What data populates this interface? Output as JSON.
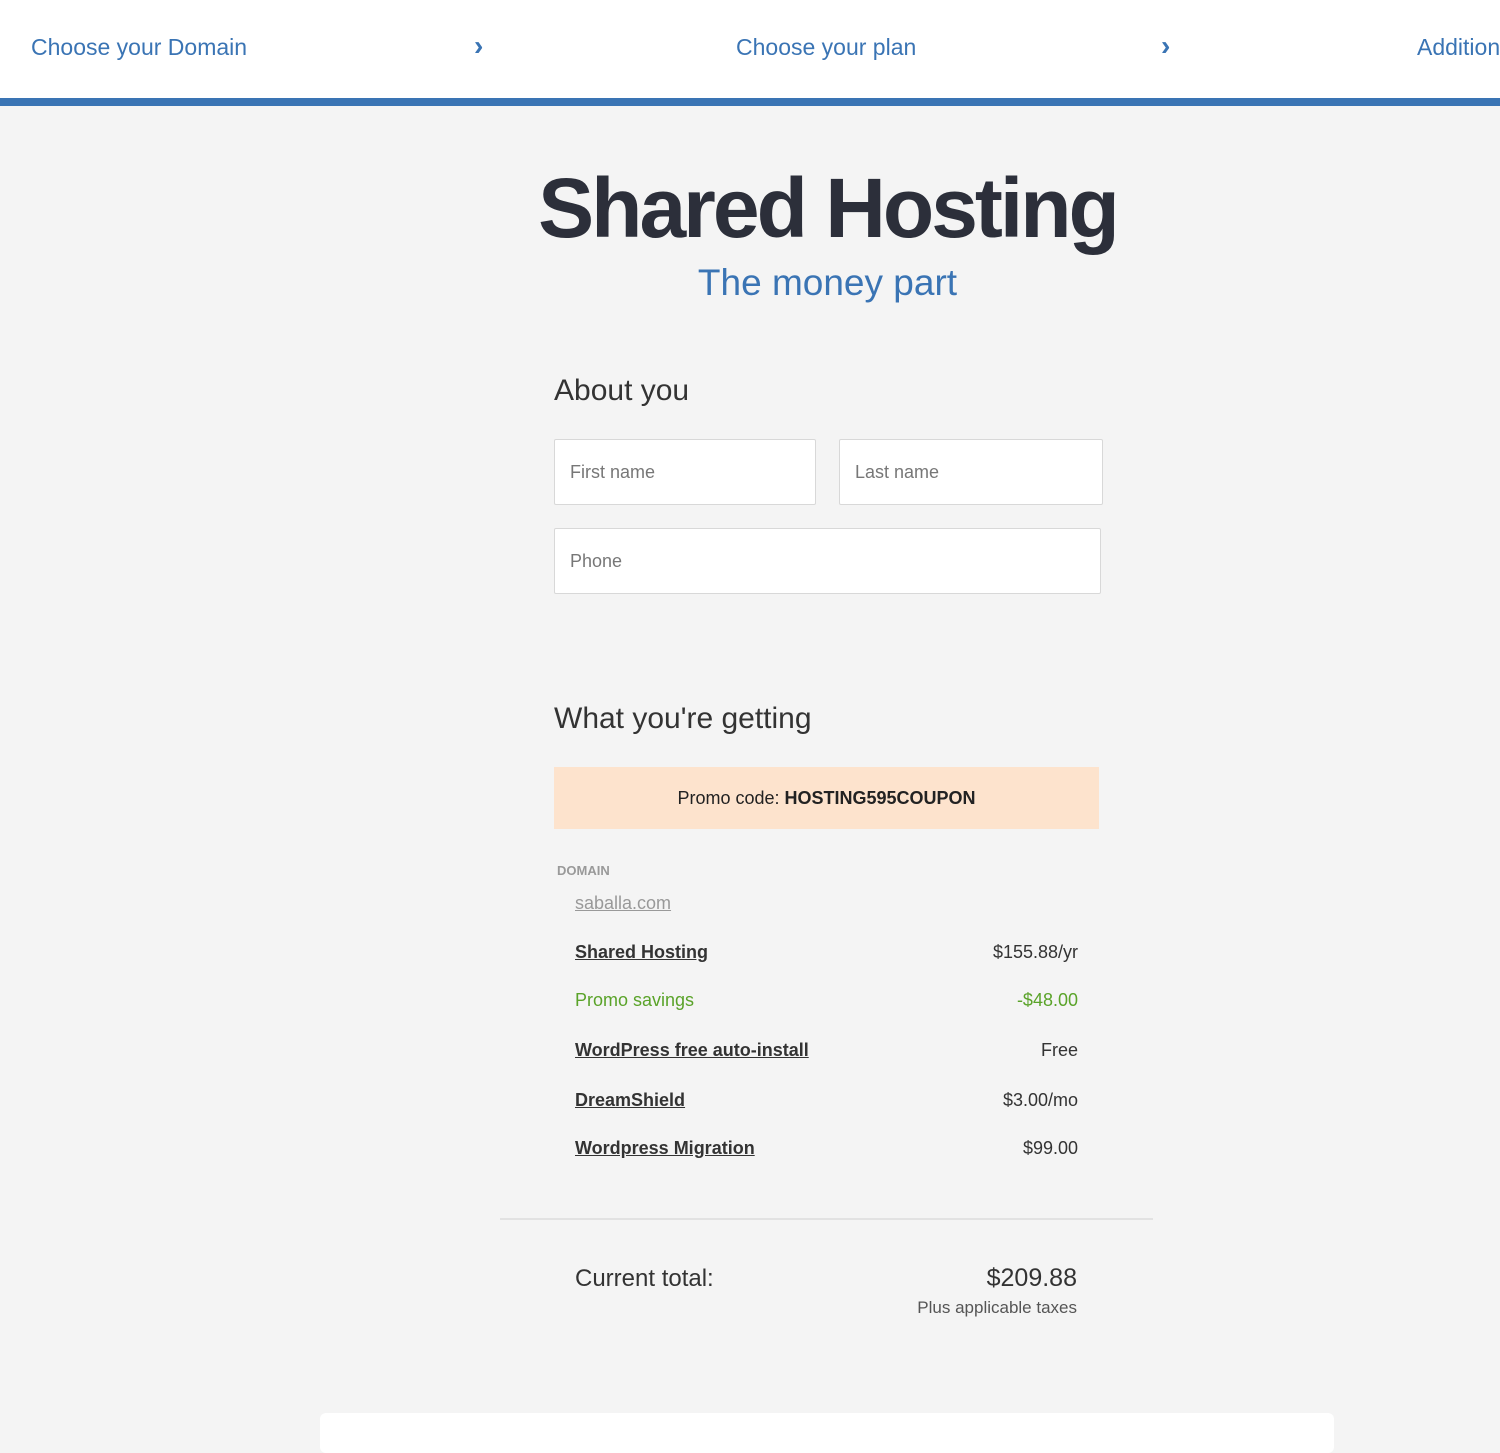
{
  "steps": [
    {
      "label": "Choose your Domain"
    },
    {
      "label": "Choose your plan"
    },
    {
      "label": "Addition"
    }
  ],
  "header": {
    "title": "Shared Hosting",
    "subtitle": "The money part"
  },
  "about": {
    "heading": "About you",
    "first_name_placeholder": "First name",
    "last_name_placeholder": "Last name",
    "phone_placeholder": "Phone"
  },
  "getting": {
    "heading": "What you're getting",
    "promo_label": "Promo code:",
    "promo_code": "HOSTING595COUPON",
    "domain_label": "DOMAIN",
    "domain": "saballa.com",
    "items": [
      {
        "name": "Shared Hosting",
        "value": "$155.88/yr"
      },
      {
        "name": "Promo savings",
        "value": "-$48.00"
      },
      {
        "name": "WordPress free auto-install",
        "value": "Free"
      },
      {
        "name": "DreamShield",
        "value": "$3.00/mo"
      },
      {
        "name": "Wordpress Migration",
        "value": "$99.00"
      }
    ],
    "total_label": "Current total:",
    "total": "$209.88",
    "taxes": "Plus applicable taxes"
  },
  "colors": {
    "accent": "#3a74b4",
    "promo_bg": "#fde3cd",
    "savings": "#5aa329"
  }
}
